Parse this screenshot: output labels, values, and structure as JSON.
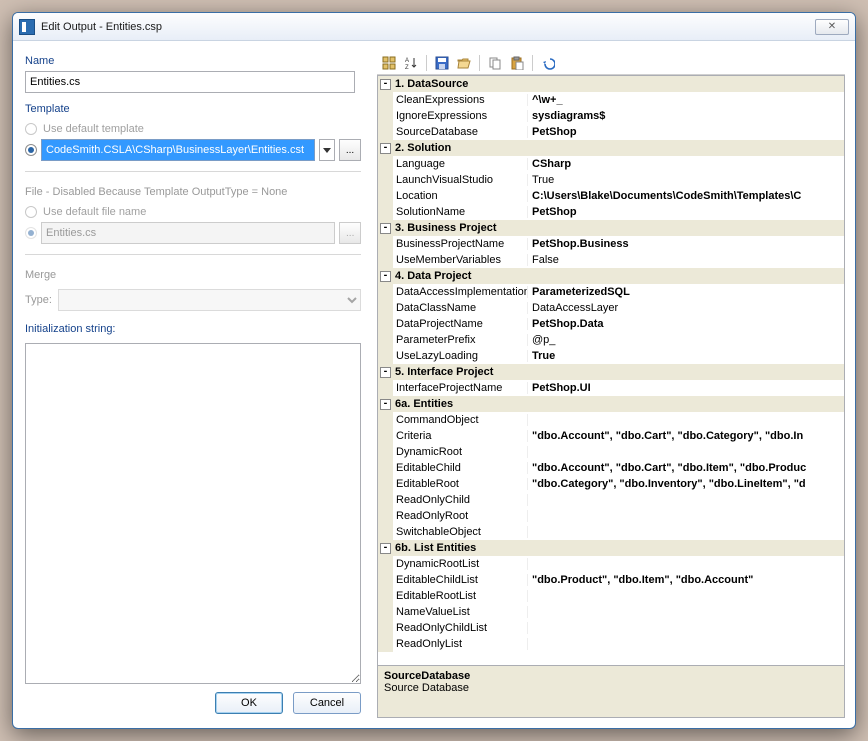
{
  "window": {
    "title": "Edit Output - Entities.csp"
  },
  "left": {
    "name_label": "Name",
    "name_value": "Entities.cs",
    "template_label": "Template",
    "use_default_template_label": "Use default template",
    "template_path": "CodeSmith.CSLA\\CSharp\\BusinessLayer\\Entities.cst",
    "file_section_label": "File - Disabled Because Template OutputType = None",
    "use_default_file_label": "Use default file name",
    "file_value": "Entities.cs",
    "merge_label": "Merge",
    "type_label": "Type:",
    "init_label": "Initialization string:",
    "ok_label": "OK",
    "cancel_label": "Cancel",
    "ellipsis": "..."
  },
  "desc": {
    "name": "SourceDatabase",
    "text": "Source Database"
  },
  "categories": [
    {
      "label": "1. DataSource",
      "rows": [
        {
          "name": "CleanExpressions",
          "value": "^\\w+_",
          "bold": true
        },
        {
          "name": "IgnoreExpressions",
          "value": "sysdiagrams$",
          "bold": true
        },
        {
          "name": "SourceDatabase",
          "value": "PetShop",
          "bold": true
        }
      ]
    },
    {
      "label": "2. Solution",
      "rows": [
        {
          "name": "Language",
          "value": "CSharp",
          "bold": true
        },
        {
          "name": "LaunchVisualStudio",
          "value": "True",
          "bold": false
        },
        {
          "name": "Location",
          "value": "C:\\Users\\Blake\\Documents\\CodeSmith\\Templates\\C",
          "bold": true
        },
        {
          "name": "SolutionName",
          "value": "PetShop",
          "bold": true
        }
      ]
    },
    {
      "label": "3. Business Project",
      "rows": [
        {
          "name": "BusinessProjectName",
          "value": "PetShop.Business",
          "bold": true
        },
        {
          "name": "UseMemberVariables",
          "value": "False",
          "bold": false
        }
      ]
    },
    {
      "label": "4. Data Project",
      "rows": [
        {
          "name": "DataAccessImplementation",
          "value": "ParameterizedSQL",
          "bold": true
        },
        {
          "name": "DataClassName",
          "value": "DataAccessLayer",
          "bold": false
        },
        {
          "name": "DataProjectName",
          "value": "PetShop.Data",
          "bold": true
        },
        {
          "name": "ParameterPrefix",
          "value": "@p_",
          "bold": false
        },
        {
          "name": "UseLazyLoading",
          "value": "True",
          "bold": true
        }
      ]
    },
    {
      "label": "5. Interface Project",
      "rows": [
        {
          "name": "InterfaceProjectName",
          "value": "PetShop.UI",
          "bold": true
        }
      ]
    },
    {
      "label": "6a. Entities",
      "rows": [
        {
          "name": "CommandObject",
          "value": "",
          "bold": false
        },
        {
          "name": "Criteria",
          "value": "\"dbo.Account\", \"dbo.Cart\", \"dbo.Category\", \"dbo.In",
          "bold": true
        },
        {
          "name": "DynamicRoot",
          "value": "",
          "bold": false
        },
        {
          "name": "EditableChild",
          "value": "\"dbo.Account\", \"dbo.Cart\", \"dbo.Item\", \"dbo.Produc",
          "bold": true
        },
        {
          "name": "EditableRoot",
          "value": "\"dbo.Category\", \"dbo.Inventory\", \"dbo.LineItem\", \"d",
          "bold": true
        },
        {
          "name": "ReadOnlyChild",
          "value": "",
          "bold": false
        },
        {
          "name": "ReadOnlyRoot",
          "value": "",
          "bold": false
        },
        {
          "name": "SwitchableObject",
          "value": "",
          "bold": false
        }
      ]
    },
    {
      "label": "6b. List Entities",
      "rows": [
        {
          "name": "DynamicRootList",
          "value": "",
          "bold": false
        },
        {
          "name": "EditableChildList",
          "value": "\"dbo.Product\", \"dbo.Item\", \"dbo.Account\"",
          "bold": true
        },
        {
          "name": "EditableRootList",
          "value": "",
          "bold": false
        },
        {
          "name": "NameValueList",
          "value": "",
          "bold": false
        },
        {
          "name": "ReadOnlyChildList",
          "value": "",
          "bold": false
        },
        {
          "name": "ReadOnlyList",
          "value": "",
          "bold": false
        }
      ]
    }
  ]
}
